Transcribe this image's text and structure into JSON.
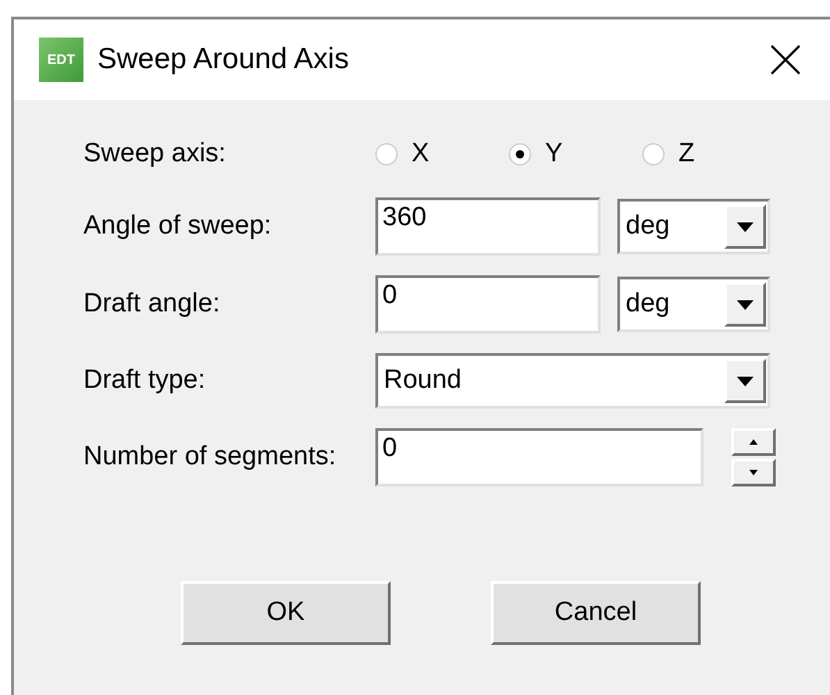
{
  "window": {
    "title": "Sweep Around Axis",
    "logo_text": "EDT"
  },
  "sweep_axis": {
    "label": "Sweep axis:",
    "options": [
      {
        "label": "X",
        "selected": false
      },
      {
        "label": "Y",
        "selected": true
      },
      {
        "label": "Z",
        "selected": false
      }
    ]
  },
  "fields": [
    {
      "kind": "unit",
      "label": "Angle of sweep:",
      "value": "360",
      "unit": "deg"
    },
    {
      "kind": "unit",
      "label": "Draft angle:",
      "value": "0",
      "unit": "deg"
    },
    {
      "kind": "select",
      "label": "Draft type:",
      "value": "Round"
    },
    {
      "kind": "spin",
      "label": "Number of segments:",
      "value": "0"
    }
  ],
  "buttons": [
    "OK",
    "Cancel"
  ]
}
